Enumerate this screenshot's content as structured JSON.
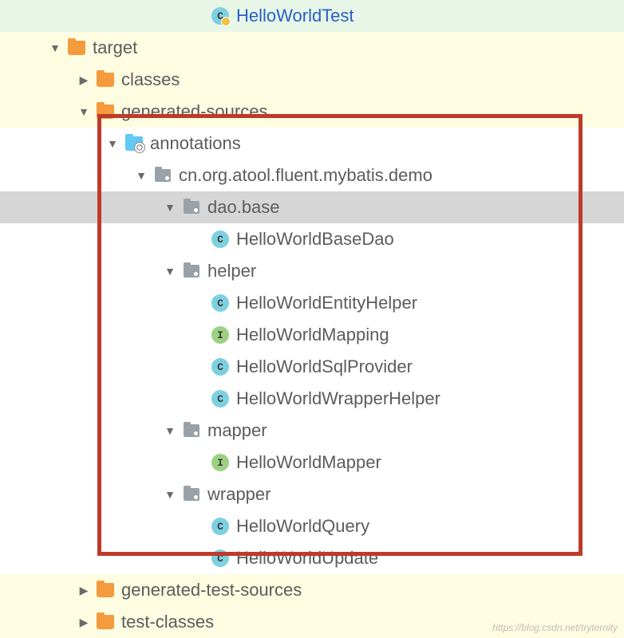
{
  "rows": [
    {
      "indent": 6,
      "arrow": "none",
      "icon": "class-c-test",
      "label": "HelloWorldTest",
      "link": true,
      "bg": "green"
    },
    {
      "indent": 1,
      "arrow": "down",
      "icon": "folder",
      "label": "target",
      "bg": "yellow"
    },
    {
      "indent": 2,
      "arrow": "right",
      "icon": "folder",
      "label": "classes",
      "bg": "yellow"
    },
    {
      "indent": 2,
      "arrow": "down",
      "icon": "folder",
      "label": "generated-sources",
      "bg": "yellow"
    },
    {
      "indent": 3,
      "arrow": "down",
      "icon": "folder-gen",
      "label": "annotations",
      "bg": "white"
    },
    {
      "indent": 4,
      "arrow": "down",
      "icon": "pkg",
      "label": "cn.org.atool.fluent.mybatis.demo",
      "bg": "white"
    },
    {
      "indent": 5,
      "arrow": "down",
      "icon": "pkg",
      "label": "dao.base",
      "bg": "sel"
    },
    {
      "indent": 6,
      "arrow": "none",
      "icon": "class-c-run",
      "label": "HelloWorldBaseDao",
      "bg": "white"
    },
    {
      "indent": 5,
      "arrow": "down",
      "icon": "pkg",
      "label": "helper",
      "bg": "white"
    },
    {
      "indent": 6,
      "arrow": "none",
      "icon": "class-c",
      "label": "HelloWorldEntityHelper",
      "bg": "white"
    },
    {
      "indent": 6,
      "arrow": "none",
      "icon": "class-i",
      "label": "HelloWorldMapping",
      "bg": "white"
    },
    {
      "indent": 6,
      "arrow": "none",
      "icon": "class-c",
      "label": "HelloWorldSqlProvider",
      "bg": "white"
    },
    {
      "indent": 6,
      "arrow": "none",
      "icon": "class-c",
      "label": "HelloWorldWrapperHelper",
      "bg": "white"
    },
    {
      "indent": 5,
      "arrow": "down",
      "icon": "pkg",
      "label": "mapper",
      "bg": "white"
    },
    {
      "indent": 6,
      "arrow": "none",
      "icon": "class-i",
      "label": "HelloWorldMapper",
      "bg": "white"
    },
    {
      "indent": 5,
      "arrow": "down",
      "icon": "pkg",
      "label": "wrapper",
      "bg": "white"
    },
    {
      "indent": 6,
      "arrow": "none",
      "icon": "class-c",
      "label": "HelloWorldQuery",
      "bg": "white"
    },
    {
      "indent": 6,
      "arrow": "none",
      "icon": "class-c",
      "label": "HelloWorldUpdate",
      "bg": "white"
    },
    {
      "indent": 2,
      "arrow": "right",
      "icon": "folder",
      "label": "generated-test-sources",
      "bg": "yellow"
    },
    {
      "indent": 2,
      "arrow": "right",
      "icon": "folder",
      "label": "test-classes",
      "bg": "yellow"
    }
  ],
  "watermark": "https://blog.csdn.net/tryternity"
}
